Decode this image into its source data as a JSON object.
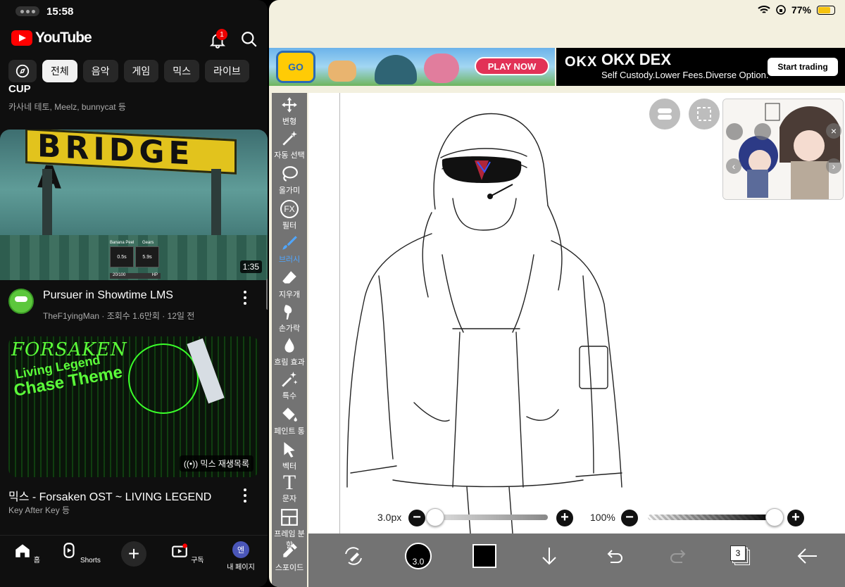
{
  "youtube": {
    "time": "15:58",
    "logo_text": "YouTube",
    "notification_count": "1",
    "chips": [
      "전체",
      "음악",
      "게임",
      "믹스",
      "라이브"
    ],
    "prev_video": {
      "title_fragment": "CUP",
      "channels": "카사네 테토, Meelz, bunnycat 등"
    },
    "video1": {
      "sign_text": "BRIDGE A",
      "hud_labels": [
        "Banana Peel",
        "Gears"
      ],
      "hud_values": [
        "0.5s",
        "5.9s"
      ],
      "hud_bar": "20/100",
      "hud_hp": "HP",
      "duration": "1:35",
      "title": "Pursuer in Showtime LMS",
      "meta": "TheF1yingMan · 조회수 1.6만회 · 12일 전"
    },
    "video2": {
      "thumb_title": "FORSAKEN",
      "thumb_line1": "Living Legend",
      "thumb_line2": "Chase Theme",
      "badge": "믹스 재생목록",
      "title": "믹스 - Forsaken OST ~ LIVING LEGEND",
      "meta": "Key After Key 등"
    },
    "nav": [
      {
        "label": "홈",
        "icon": "home-icon"
      },
      {
        "label": "Shorts",
        "icon": "shorts-icon"
      },
      {
        "label": "",
        "icon": "plus-icon"
      },
      {
        "label": "구독",
        "icon": "subscriptions-icon"
      },
      {
        "label": "내 페이지",
        "icon": "profile-icon"
      }
    ],
    "profile_initial": "엔"
  },
  "ibis": {
    "battery": "77%",
    "ad_pokemon": {
      "logo": "GO",
      "cta": "PLAY NOW"
    },
    "ad_okx": {
      "logo": "OKX",
      "title": "OKX DEX",
      "subtitle": "Self Custody.Lower Fees.Diverse Option.",
      "button": "Start trading"
    },
    "tools": [
      {
        "label": "변형",
        "icon": "move-icon"
      },
      {
        "label": "자동 선택",
        "icon": "magic-wand-icon"
      },
      {
        "label": "올가미",
        "icon": "lasso-icon"
      },
      {
        "label": "필터",
        "icon": "fx-icon"
      },
      {
        "label": "브러시",
        "icon": "brush-icon"
      },
      {
        "label": "지우개",
        "icon": "eraser-icon"
      },
      {
        "label": "손가락",
        "icon": "smudge-icon"
      },
      {
        "label": "흐림 효과",
        "icon": "blur-icon"
      },
      {
        "label": "특수",
        "icon": "special-icon"
      },
      {
        "label": "페인트 통",
        "icon": "bucket-icon"
      },
      {
        "label": "벡터",
        "icon": "vector-icon"
      },
      {
        "label": "문자",
        "icon": "text-icon"
      },
      {
        "label": "프레임 분할",
        "icon": "frame-icon"
      },
      {
        "label": "스포이드",
        "icon": "eyedropper-icon"
      }
    ],
    "active_tool": "브러시",
    "fx_label": "FX",
    "text_tool_glyph": "T",
    "brush_size": "3.0px",
    "brush_size_fraction": 0.0,
    "opacity": "100%",
    "opacity_fraction": 1.0,
    "brush_chip": "3.0",
    "layer_count": "3",
    "colors": {
      "primary": "#000000",
      "toolbar": "#737373",
      "accent": "#4fa6ff"
    }
  }
}
